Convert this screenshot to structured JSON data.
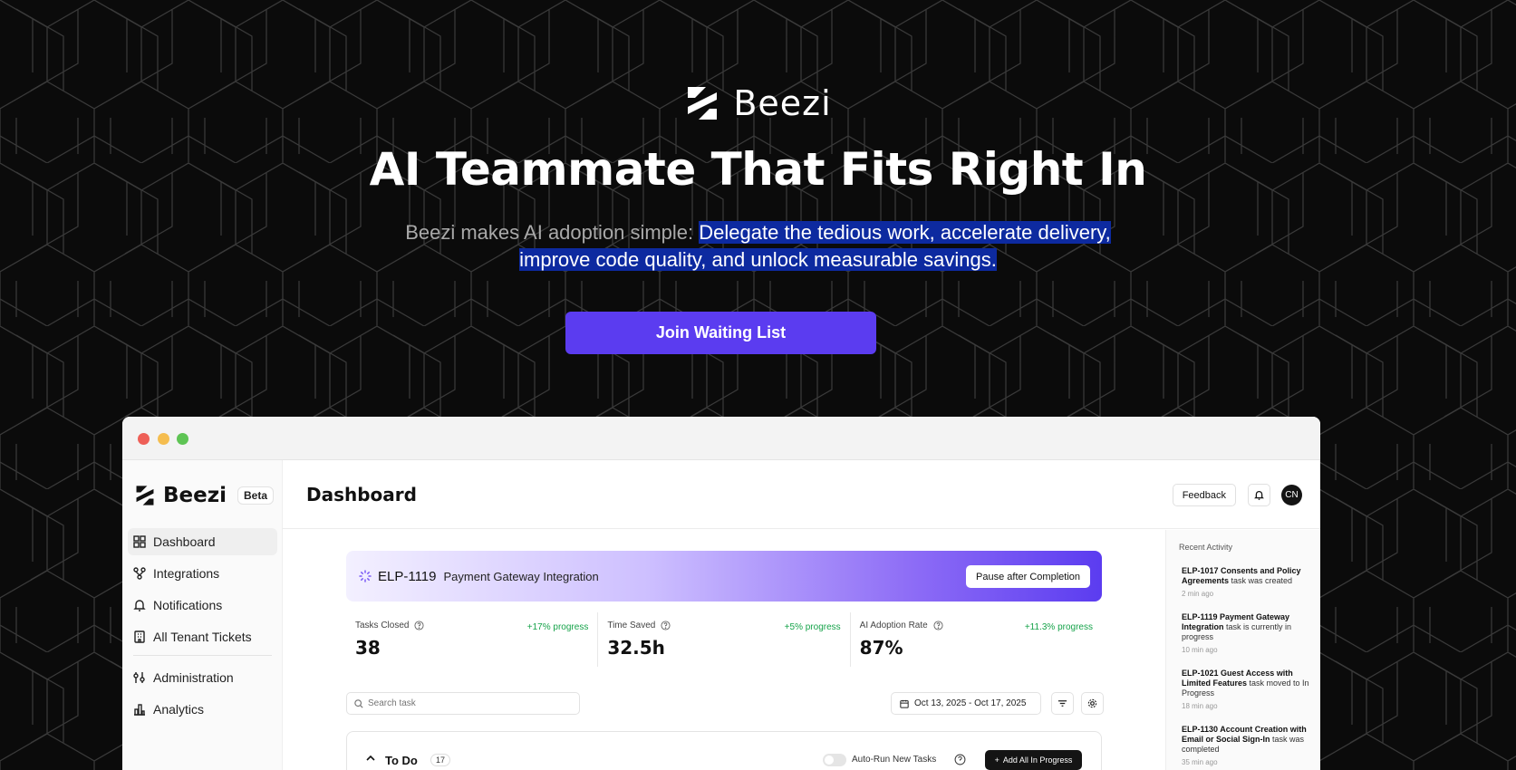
{
  "hero": {
    "brand": "Beezi",
    "title": "AI Teammate That Fits Right In",
    "subtitle_plain": "Beezi makes AI adoption simple: ",
    "subtitle_highlight_1": "Delegate the tedious work, accelerate delivery,",
    "subtitle_highlight_2": "improve code quality, and unlock measurable savings.",
    "cta_label": "Join Waiting List"
  },
  "app": {
    "brand": "Beezi",
    "badge": "Beta",
    "nav": [
      {
        "label": "Dashboard",
        "icon": "grid-icon",
        "active": true
      },
      {
        "label": "Integrations",
        "icon": "integrations-icon"
      },
      {
        "label": "Notifications",
        "icon": "bell-icon"
      },
      {
        "label": "All Tenant Tickets",
        "icon": "building-icon"
      },
      {
        "label": "Administration",
        "icon": "sliders-icon"
      },
      {
        "label": "Analytics",
        "icon": "bar-chart-icon"
      }
    ],
    "page_title": "Dashboard",
    "feedback_label": "Feedback",
    "avatar_initials": "CN",
    "banner": {
      "ticket_id": "ELP-1119",
      "ticket_name": "Payment Gateway Integration",
      "pause_label": "Pause after Completion"
    },
    "stats": [
      {
        "label": "Tasks Closed",
        "value": "38",
        "progress": "+17% progress"
      },
      {
        "label": "Time Saved",
        "value": "32.5h",
        "progress": "+5% progress"
      },
      {
        "label": "AI Adoption Rate",
        "value": "87%",
        "progress": "+11.3% progress"
      }
    ],
    "search_placeholder": "Search task",
    "date_range": "Oct 13, 2025 - Oct 17, 2025",
    "todo": {
      "title": "To Do",
      "count": "17",
      "autorun_label": "Auto-Run New Tasks",
      "add_label": "Add All In Progress"
    },
    "activity": {
      "title": "Recent Activity",
      "items": [
        {
          "id": "ELP-1017 Consents and Policy Agreements",
          "text": " task was created",
          "time": "2 min ago"
        },
        {
          "id": "ELP-1119 Payment Gateway Integration",
          "text": " task is currently in progress",
          "time": "10 min ago"
        },
        {
          "id": "ELP-1021 Guest Access with Limited Features",
          "text": " task moved to In Progress",
          "time": "18 min ago"
        },
        {
          "id": "ELP-1130 Account Creation with Email or Social Sign-In",
          "text": " task was completed",
          "time": "35 min ago"
        }
      ]
    }
  },
  "colors": {
    "accent": "#5b3cf0",
    "background": "#0b0b0b",
    "highlight": "#0d2aa0",
    "progress_green": "#16a34a"
  }
}
